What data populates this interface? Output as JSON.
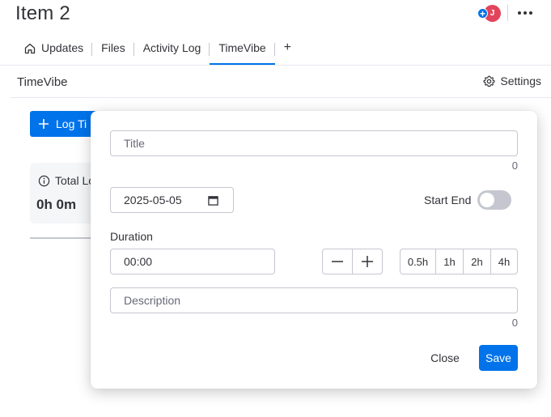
{
  "header": {
    "title": "Item 2",
    "avatar_initial": "J",
    "avatar_plus": "+"
  },
  "tabs": [
    {
      "label": "Updates",
      "icon": "home-icon"
    },
    {
      "label": "Files"
    },
    {
      "label": "Activity Log"
    },
    {
      "label": "TimeVibe",
      "active": true
    }
  ],
  "tab_add": "+",
  "app": {
    "title": "TimeVibe",
    "settings_label": "Settings"
  },
  "background": {
    "log_button_label": "Log Ti",
    "total_label": "Total Lo",
    "total_value": "0h 0m"
  },
  "dialog": {
    "title_placeholder": "Title",
    "title_count": "0",
    "date_value": "2025-05-05",
    "toggle_label": "Start End",
    "toggle_on": false,
    "duration_label": "Duration",
    "duration_value": "00:00",
    "quick_options": [
      "0.5h",
      "1h",
      "2h",
      "4h"
    ],
    "description_placeholder": "Description",
    "description_count": "0",
    "close_label": "Close",
    "save_label": "Save"
  },
  "colors": {
    "accent": "#0073ea",
    "avatar": "#e2445c"
  }
}
